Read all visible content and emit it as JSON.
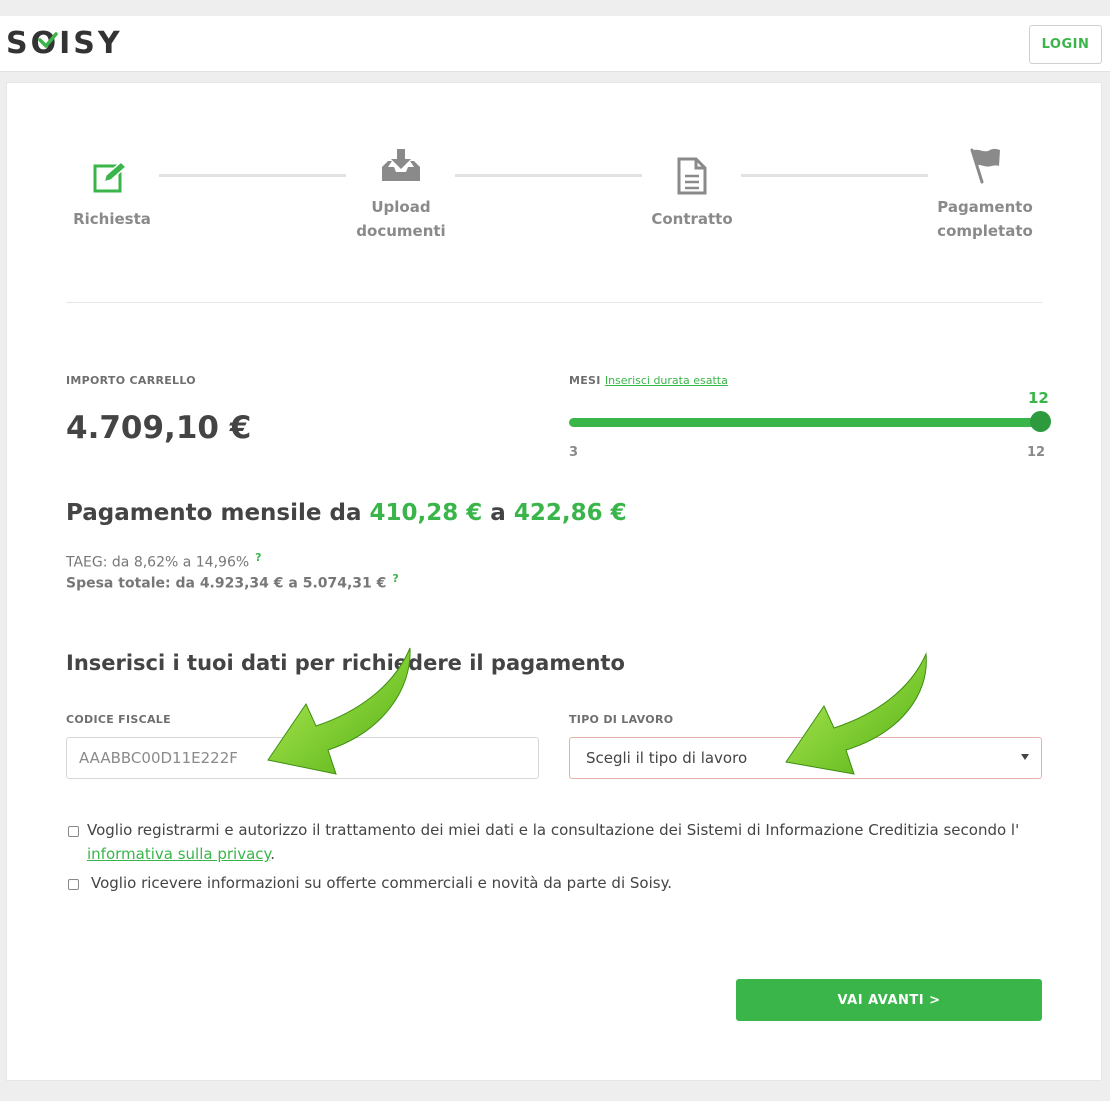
{
  "header": {
    "logo_text": "SOISY",
    "login_label": "LOGIN"
  },
  "steps": [
    {
      "label_line1": "Richiesta",
      "label_line2": "",
      "icon": "edit-icon",
      "active": true
    },
    {
      "label_line1": "Upload",
      "label_line2": "documenti",
      "icon": "download-tray-icon",
      "active": false
    },
    {
      "label_line1": "Contratto",
      "label_line2": "",
      "icon": "document-icon",
      "active": false
    },
    {
      "label_line1": "Pagamento",
      "label_line2": "completato",
      "icon": "flag-icon",
      "active": false
    }
  ],
  "cart": {
    "label": "IMPORTO CARRELLO",
    "amount": "4.709,10 €"
  },
  "months": {
    "label": "MESI",
    "link": "Inserisci durata esatta",
    "value": "12",
    "min": "3",
    "max": "12",
    "fill": 1.0
  },
  "payment": {
    "prefix": "Pagamento mensile da",
    "from": "410,28 €",
    "mid": "a",
    "to": "422,86 €",
    "taeg": "TAEG: da 8,62% a 14,96%",
    "spesa": "Spesa totale: da 4.923,34 € a 5.074,31 €",
    "help": "?"
  },
  "form": {
    "title": "Inserisci i tuoi dati per richiedere il pagamento",
    "cf_label": "CODICE FISCALE",
    "cf_placeholder": "AAABBC00D11E222F",
    "job_label": "TIPO DI LAVORO",
    "job_value": "Scegli il tipo di lavoro",
    "consent1_text": "Voglio registrarmi e autorizzo il trattamento dei miei dati e la consultazione dei Sistemi di Informazione Creditizia secondo l'",
    "consent1_link": "informativa sulla privacy",
    "consent1_end": ".",
    "consent2_text": "Voglio ricevere informazioni su offerte commerciali e novità da parte di Soisy.",
    "submit_label": "VAI AVANTI >"
  },
  "colors": {
    "accent": "#3ab54a",
    "accent_dark": "#2e9a3e",
    "arrow_green": "#7fd321"
  }
}
